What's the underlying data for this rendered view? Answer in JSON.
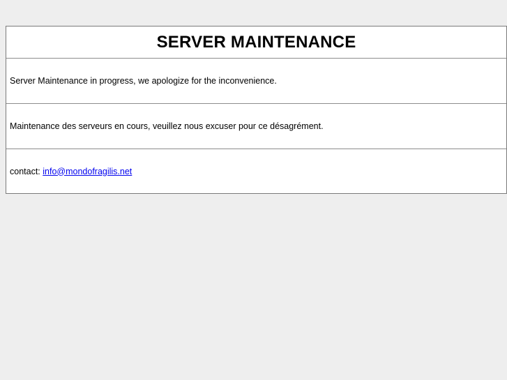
{
  "page": {
    "title": "SERVER MAINTENANCE",
    "message_en": "Server Maintenance in progress, we apologize for the inconvenience.",
    "message_fr": "Maintenance des serveurs en cours, veuillez nous excuser pour ce désagrément.",
    "contact_label": "contact: ",
    "contact_email": "info@mondofragilis.net"
  },
  "colors": {
    "background": "#eeeeee",
    "panel": "#ffffff",
    "border": "#7a7a7a",
    "link": "#0000ee"
  }
}
